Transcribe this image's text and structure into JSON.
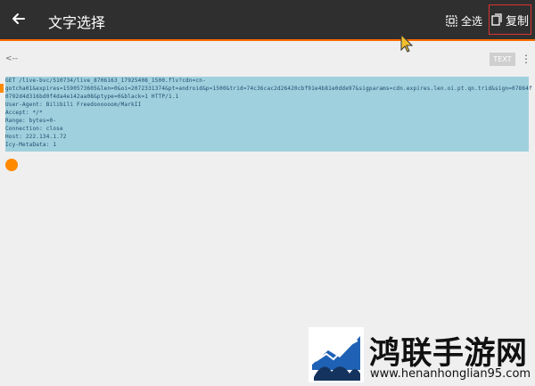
{
  "toolbar": {
    "title": "文字选择",
    "select_all": "全选",
    "copy": "复制"
  },
  "content": {
    "prev_label": "<--",
    "text_button": "TEXT",
    "lines": [
      "GET /live-bvc/510734/live_8706163_17925408_1500.flv?cdn=cn-",
      "gotcha01&expires=1590573605&len=0&oi=2072331374&pt=android&p=1500&trid=74c36cac2d26420cbf91e4b81e0dde97&sigparams=cdn.expires.len.oi.pt.qn.trid&sign=07864f",
      "0792d4d316bd0f4da4e142aa08&ptype=0&black=1 HTTP/1.1",
      "User-Agent: Bilibili Freedoooooom/MarkII",
      "Accept: */*",
      "Range: bytes=0-",
      "Connection: close",
      "Host: 222.134.1.72",
      "Icy-MetaData: 1"
    ]
  },
  "watermark": {
    "brand": "鸿联手游网",
    "domain": "www.henanhonglian95.com"
  },
  "colors": {
    "toolbar_bg": "#2f2f2f",
    "accent": "#ff6a00",
    "selection": "#9fd0dd"
  }
}
